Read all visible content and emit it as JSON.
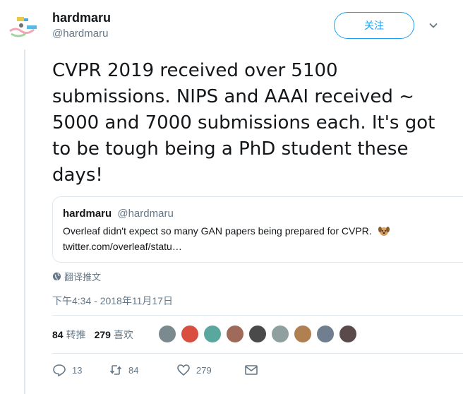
{
  "author": {
    "name": "hardmaru",
    "handle": "@hardmaru"
  },
  "follow_button": "关注",
  "tweet": {
    "text": "CVPR 2019 received over 5100 submissions. NIPS and AAAI received ~ 5000 and 7000 submissions each. It's got to be tough being a PhD student these days!"
  },
  "quote": {
    "name": "hardmaru",
    "handle": "@hardmaru",
    "text": "Overleaf didn't expect so many GAN papers being prepared for CVPR.",
    "link": "twitter.com/overleaf/statu…"
  },
  "translate_label": "翻译推文",
  "timestamp": "下午4:34 - 2018年11月17日",
  "stats": {
    "retweets_count": "84",
    "retweets_label": "转推",
    "likes_count": "279",
    "likes_label": "喜欢"
  },
  "likers": [
    "#7a8a8f",
    "#d94f3f",
    "#5aa7a0",
    "#a06a5a",
    "#4a4a4a",
    "#8fa0a0",
    "#b08050",
    "#6f7f8f",
    "#5a4a4a"
  ],
  "actions": {
    "replies": "13",
    "retweets": "84",
    "likes": "279"
  },
  "colors": {
    "accent": "#1da1f2",
    "muted": "#657786",
    "border": "#e1e8ed"
  }
}
